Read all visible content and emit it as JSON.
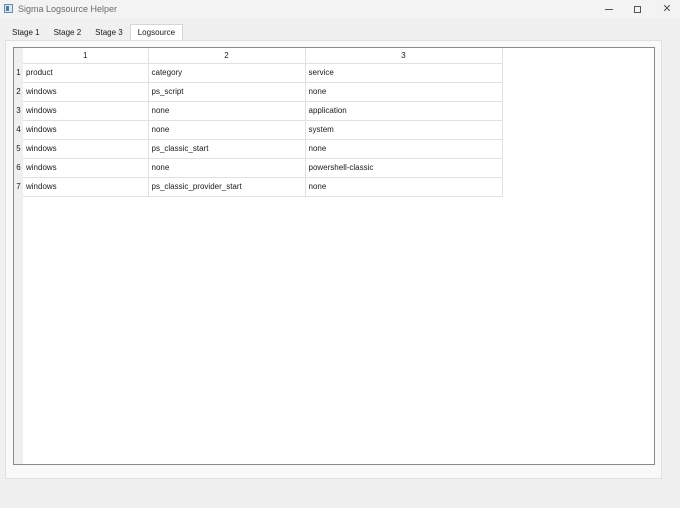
{
  "window": {
    "title": "Sigma Logsource Helper",
    "controls": {
      "minimize_icon": "minimize-icon",
      "maximize_icon": "maximize-icon",
      "close_icon": "close-icon"
    }
  },
  "tabs": [
    {
      "label": "Stage 1",
      "active": false
    },
    {
      "label": "Stage 2",
      "active": false
    },
    {
      "label": "Stage 3",
      "active": false
    },
    {
      "label": "Logsource",
      "active": true
    }
  ],
  "grid": {
    "column_headers": [
      "1",
      "2",
      "3"
    ],
    "rows": [
      {
        "num": "1",
        "cells": [
          "product",
          "category",
          "service"
        ]
      },
      {
        "num": "2",
        "cells": [
          "windows",
          "ps_script",
          "none"
        ]
      },
      {
        "num": "3",
        "cells": [
          "windows",
          "none",
          "application"
        ]
      },
      {
        "num": "4",
        "cells": [
          "windows",
          "none",
          "system"
        ]
      },
      {
        "num": "5",
        "cells": [
          "windows",
          "ps_classic_start",
          "none"
        ]
      },
      {
        "num": "6",
        "cells": [
          "windows",
          "none",
          "powershell-classic"
        ]
      },
      {
        "num": "7",
        "cells": [
          "windows",
          "ps_classic_provider_start",
          "none"
        ]
      }
    ]
  }
}
